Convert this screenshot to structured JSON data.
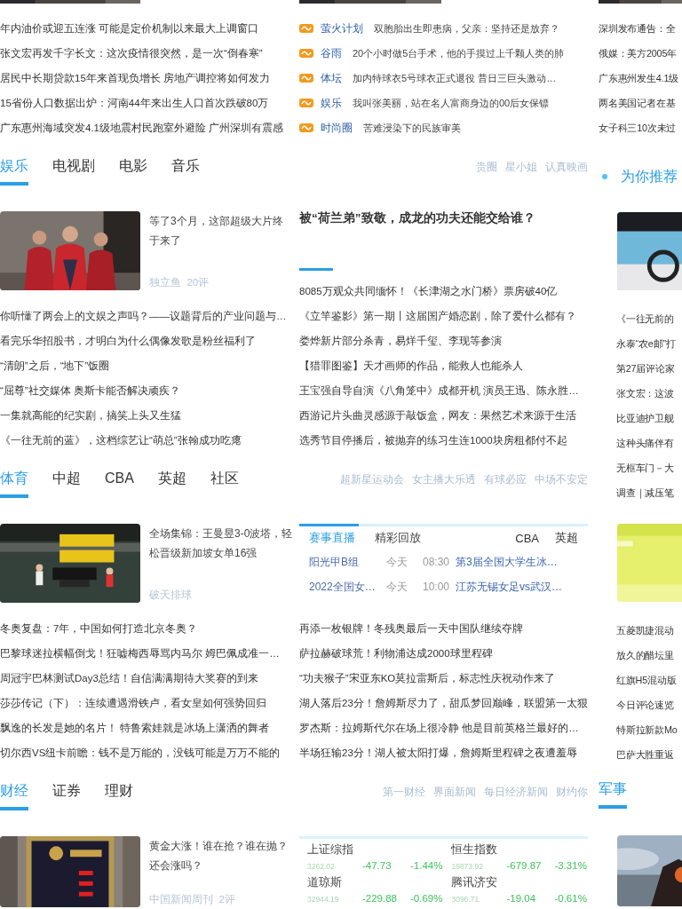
{
  "top_news": {
    "left": [
      "年内油价或迎五连涨 可能是定价机制以来最大上调窗口",
      "张文宏再发千字长文：这次疫情很突然，是一次“倒春寒”",
      "居民中长期贷款15年来首现负增长 房地产调控将如何发力",
      "15省份人口数据出炉：河南44年来出生人口首次跌破80万",
      "广东惠州海域突发4.1级地震村民跑室外避险 广州深圳有震感"
    ],
    "center": [
      {
        "category": "萤火计划",
        "text": "双胞胎出生即患病，父亲：坚持还是放弃？"
      },
      {
        "category": "谷雨",
        "text": "20个小时做5台手术，他的手摸过上千颗人类的肺"
      },
      {
        "category": "体坛",
        "text": "加内特球衣5号球衣正式退役 昔日三巨头激动…"
      },
      {
        "category": "娱乐",
        "text": "我叫张美丽，站在名人富商身边的00后女保镖"
      },
      {
        "category": "时尚圈",
        "text": "苦难浸染下的民族审美"
      }
    ]
  },
  "sections": [
    {
      "kind": "entertainment",
      "tabs": [
        {
          "label": "娱乐",
          "selected": true
        },
        {
          "label": "电视剧",
          "selected": false
        },
        {
          "label": "电影",
          "selected": false
        },
        {
          "label": "音乐",
          "selected": false
        }
      ],
      "links": [
        "贵圈",
        "星小姐",
        "认真映画"
      ],
      "feature": {
        "title": "等了3个月，这部超级大片终于来了",
        "source": "独立鱼  20评"
      },
      "list": [
        "你听懂了两会上的文娱之声吗？——议题背后的产业问题与…",
        "看完乐华招股书，才明白为什么偶像发歌是粉丝福利了",
        "“清朗”之后，“地下”饭圈",
        "“屈尊”社交媒体 奥斯卡能否解决顽疾？",
        "一集就高能的纪实剧，搞笑上头又生猛",
        "《一往无前的蓝》，这档综艺让“萌总”张翰成功吃瘪"
      ],
      "center": {
        "kind": "headline",
        "headline": "被“荷兰弟”致敬，成龙的功夫还能交给谁？",
        "list": [
          "8085万观众共同缅怀！《长津湖之水门桥》票房破40亿",
          "《立竿鉴影》第一期丨这届国产婚恋剧，除了爱什么都有？",
          "娄烨新片部分杀青，易烊千玺、李现等参演",
          "【猎罪图鉴】天才画师的作品，能救人也能杀人",
          "王宝强自导自演《八角笼中》成都开机 演员王迅、陈永胜…",
          "西游记片头曲灵感源于敲饭盒，网友：果然艺术来源于生活",
          "选秀节目停播后，被抛弃的练习生连1000块房租都付不起"
        ]
      }
    },
    {
      "kind": "sports",
      "tabs": [
        {
          "label": "体育",
          "selected": true
        },
        {
          "label": "中超",
          "selected": false
        },
        {
          "label": "CBA",
          "selected": false
        },
        {
          "label": "英超",
          "selected": false
        },
        {
          "label": "社区",
          "selected": false
        }
      ],
      "links": [
        "超新星运动会",
        "女主播大乐透",
        "有球必应",
        "中场不安定"
      ],
      "feature": {
        "title": "全场集锦：王曼昱3-0波塔，轻松晋级新加坡女单16强",
        "source": "破天排球"
      },
      "list": [
        "冬奥复盘：7年，中国如何打造北京冬奥？",
        "巴黎球迷拉横幅倒戈！狂嘘梅西辱骂内马尔 姆巴佩成准一…",
        "周冠宇巴林测试Day3总结！自信满满期待大奖赛的到来",
        "莎莎传记（下）：连续遭遇滑铁卢，看女皇如何强势回归",
        "飘逸的长发是她的名片！ 特鲁索娃就是冰场上潇洒的舞者",
        "切尔西VS纽卡前瞻：钱不是万能的，没钱可能是万万不能的"
      ],
      "center": {
        "kind": "scores",
        "tabs": [
          {
            "label": "赛事直播",
            "selected": true
          },
          {
            "label": "精彩回放",
            "selected": false
          }
        ],
        "links": [
          "CBA",
          "英超"
        ],
        "rows": [
          {
            "league": "阳光甲B组",
            "day": "今天",
            "time": "08:30",
            "match": "第3届全国大学生冰…"
          },
          {
            "league": "2022全国女…",
            "day": "今天",
            "time": "10:00",
            "match": "江苏无锡女足vs武汉…"
          }
        ],
        "list": [
          "再添一枚银牌！冬残奥最后一天中国队继续夺牌",
          "萨拉赫破球荒！利物浦达成2000球里程碑",
          "“功夫猴子”宋亚东KO莫拉雷斯后，标志性庆祝动作来了",
          "湖人落后23分！詹姆斯尽力了，甜瓜梦回巅峰，联盟第一太狠",
          "罗杰斯：拉姆斯代尔在场上很冷静 他是目前英格兰最好的…",
          "半场狂输23分！湖人被太阳打爆，詹姆斯里程碑之夜遭羞辱"
        ]
      }
    },
    {
      "kind": "finance",
      "tabs": [
        {
          "label": "财经",
          "selected": true
        },
        {
          "label": "证券",
          "selected": false
        },
        {
          "label": "理财",
          "selected": false
        }
      ],
      "links": [
        "第一财经",
        "界面新闻",
        "每日经济新闻",
        "财约你"
      ],
      "feature": {
        "title": "黄金大涨！谁在抢？谁在抛？还会涨吗？",
        "source": "中国新闻周刊  2评"
      },
      "center": {
        "kind": "stocks",
        "indices": [
          {
            "name": "上证综指",
            "value": "3262.02",
            "change": "-47.73",
            "percent": "-1.44%"
          },
          {
            "name": "恒生指数",
            "value": "19873.92",
            "change": "-679.87",
            "percent": "-3.31%"
          },
          {
            "name": "道琼斯",
            "value": "32944.19",
            "change": "-229.88",
            "percent": "-0.69%"
          },
          {
            "name": "腾讯济安",
            "value": "3096.71",
            "change": "-19.04",
            "percent": "-0.61%"
          }
        ]
      }
    }
  ],
  "right": {
    "top_list": [
      "深圳发布通告：全",
      "俄媒：美方2005年",
      "广东惠州发生4.1级",
      "两名美国记者在基",
      "女子科三10次未过"
    ],
    "recommend": {
      "title": "为你推荐",
      "list_1": [
        "《一往无前的",
        "永泰“农e邮”打",
        "第27届评论家",
        "张文宏：这波",
        "比亚迪护卫舰",
        "这种头痛伴有",
        "无框车门－大",
        "调查｜减压笔"
      ],
      "list_2": [
        "五菱凯捷混动",
        "放久的醋坛里",
        "红旗H5混动版",
        "今日评论速览",
        "特斯拉新款Mo",
        "巴萨大胜重返"
      ]
    },
    "tabs": [
      {
        "label": "军事",
        "selected": true
      }
    ]
  }
}
